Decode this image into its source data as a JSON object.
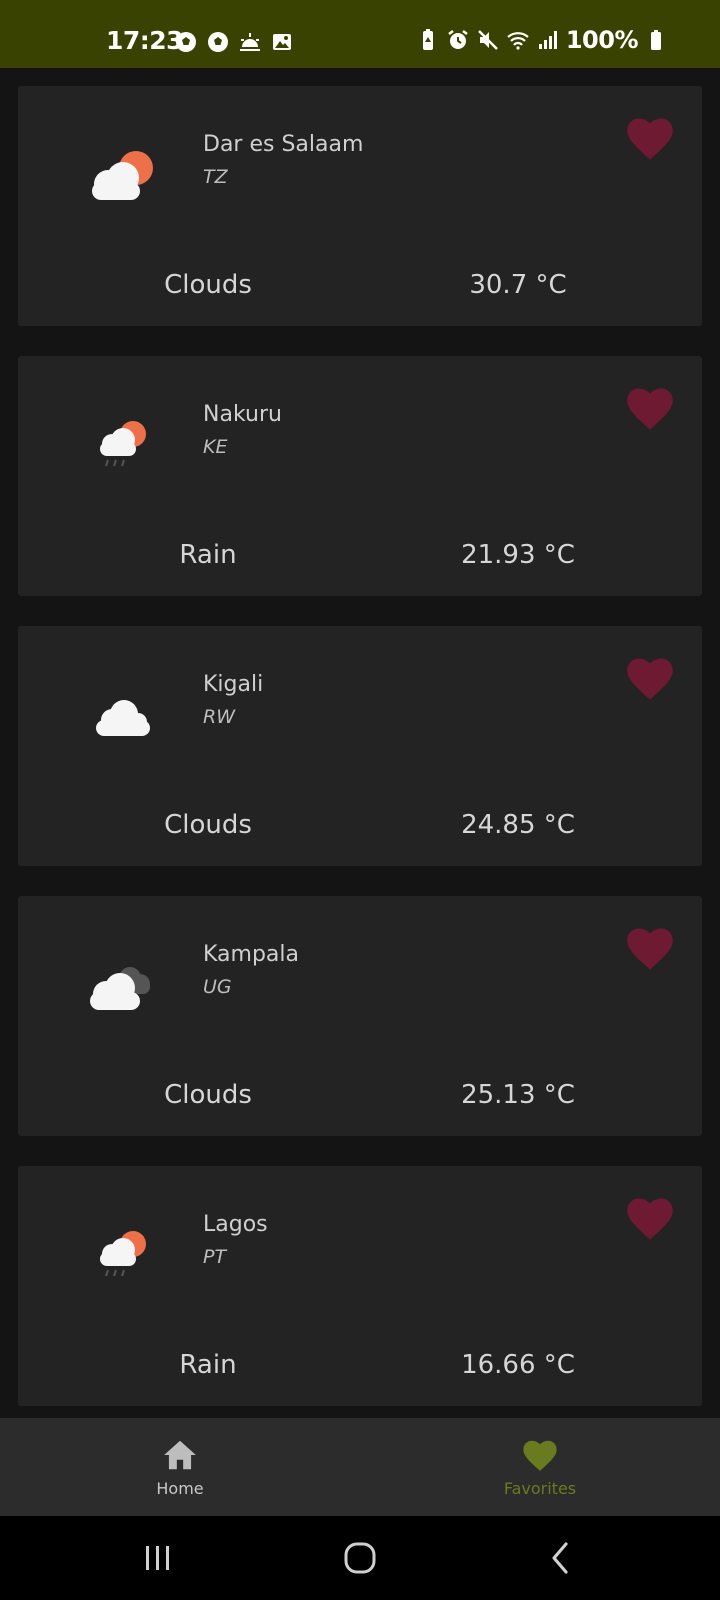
{
  "status_bar": {
    "time": "17:23",
    "battery": "100%",
    "left_icons": [
      "soccer-ball-icon",
      "soccer-ball-icon",
      "sunrise-icon",
      "image-icon"
    ],
    "right_icons": [
      "battery-saver-icon",
      "alarm-icon",
      "mute-icon",
      "wifi-icon",
      "signal-icon",
      "battery-icon"
    ],
    "background": "#3a4200"
  },
  "cards": [
    {
      "city": "Dar es Salaam",
      "country": "TZ",
      "condition": "Clouds",
      "temperature": "30.7 °C",
      "icon": "sun-behind-cloud-icon"
    },
    {
      "city": "Nakuru",
      "country": "KE",
      "condition": "Rain",
      "temperature": "21.93 °C",
      "icon": "rain-sun-cloud-icon"
    },
    {
      "city": "Kigali",
      "country": "RW",
      "condition": "Clouds",
      "temperature": "24.85 °C",
      "icon": "cloud-icon"
    },
    {
      "city": "Kampala",
      "country": "UG",
      "condition": "Clouds",
      "temperature": "25.13 °C",
      "icon": "dark-clouds-icon"
    },
    {
      "city": "Lagos",
      "country": "PT",
      "condition": "Rain",
      "temperature": "16.66 °C",
      "icon": "rain-sun-cloud-icon"
    }
  ],
  "colors": {
    "heart": "#6e1a33",
    "card": "#232323",
    "background": "#141414",
    "sun": "#ee7049",
    "nav_active": "#6a7a1e"
  },
  "bottom_nav": {
    "home_label": "Home",
    "favorites_label": "Favorites",
    "active": "Favorites"
  },
  "system_nav": [
    "recents-icon",
    "home-circle-icon",
    "back-icon"
  ]
}
